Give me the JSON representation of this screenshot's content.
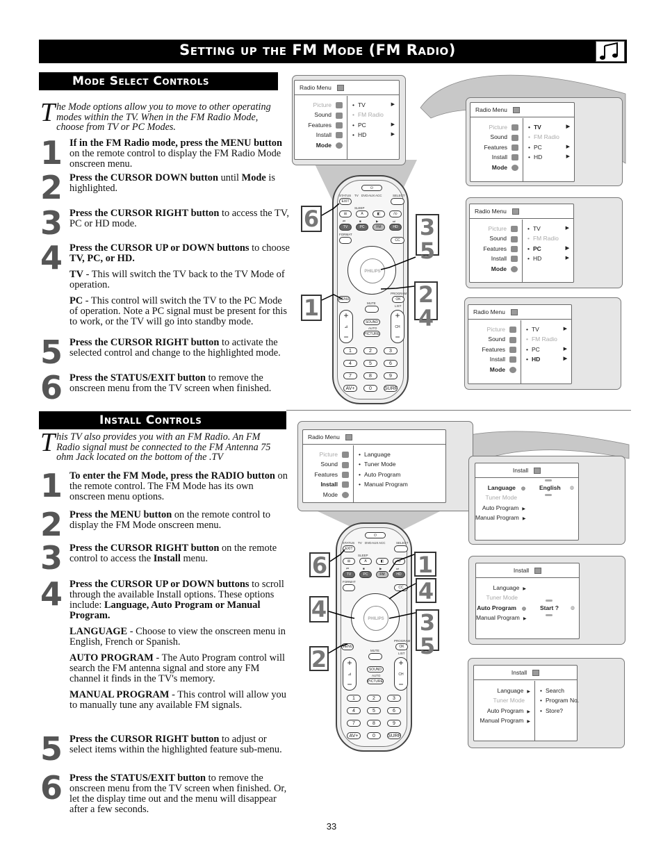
{
  "page_title": "Setting up the FM Mode (FM Radio)",
  "title_icon": "music-note-icon",
  "section1": {
    "heading": "Mode Select Controls",
    "intro_dropcap": "T",
    "intro": "he Mode options allow you to move to other operating modes within the TV. When in the FM Radio Mode, choose from TV or PC Modes.",
    "steps": [
      {
        "num": "1",
        "bold": "If in the FM Radio mode, press the MENU button",
        "rest": " on the remote control to display the FM Radio Mode onscreen menu."
      },
      {
        "num": "2",
        "bold": "Press the CURSOR DOWN button",
        "rest": " until ",
        "bold2": "Mode",
        "rest2": " is highlighted."
      },
      {
        "num": "3",
        "bold": "Press the CURSOR RIGHT button",
        "rest": " to access the TV, PC or HD mode."
      },
      {
        "num": "4",
        "bold": "Press the CURSOR UP or DOWN buttons",
        "rest": " to choose ",
        "bold2": "TV, PC, or HD.",
        "rest2": "",
        "subs": [
          {
            "term": "TV",
            "text": " - This will switch the TV back to the TV Mode of operation."
          },
          {
            "term": "PC",
            "text": " - This control will switch the TV to the PC Mode of operation. Note a PC signal must be present for this to work, or the TV will go into standby mode."
          }
        ]
      },
      {
        "num": "5",
        "bold": "Press the CURSOR RIGHT button",
        "rest": " to activate the selected control and change to the highlighted mode."
      },
      {
        "num": "6",
        "bold": "Press the STATUS/EXIT button",
        "rest": " to remove the onscreen menu from the TV screen when finished."
      }
    ],
    "radio_menu": {
      "title": "Radio Menu",
      "left_items": [
        "Picture",
        "Sound",
        "Features",
        "Install",
        "Mode"
      ],
      "right_items": [
        "TV",
        "FM Radio",
        "PC",
        "HD"
      ]
    },
    "highlight_states": [
      "TV",
      "PC",
      "HD"
    ],
    "callouts": {
      "left_top": "6",
      "left_bottom": "1",
      "right_top": "3\n5",
      "right_bottom": "2\n4"
    }
  },
  "section2": {
    "heading": "Install Controls",
    "intro_dropcap": "T",
    "intro": "his TV also provides you with an FM Radio. An FM Radio signal must be connected to the FM Antenna 75 ohm Jack located on the bottom of the .TV",
    "steps": [
      {
        "num": "1",
        "bold": "To enter the FM Mode, press the RADIO button",
        "rest": " on the remote control. The FM Mode has its own onscreen menu options."
      },
      {
        "num": "2",
        "bold": "Press the MENU button",
        "rest": " on the remote control to display the FM Mode onscreen menu."
      },
      {
        "num": "3",
        "bold": "Press the CURSOR RIGHT button",
        "rest": " on the remote control to access the ",
        "bold2": "Install",
        "rest2": " menu."
      },
      {
        "num": "4",
        "bold": "Press the CURSOR UP or DOWN buttons",
        "rest": " to scroll through the available Install options. These options include: ",
        "bold2": "Language, Auto Program or Manual Program.",
        "rest2": "",
        "subs": [
          {
            "term": "LANGUAGE",
            "text": " - Choose to view the onscreen menu in English, French or Spanish."
          },
          {
            "term": "AUTO PROGRAM",
            "text": " - The Auto Program control will search the FM antenna signal and store any FM channel it finds in the TV's memory."
          },
          {
            "term": "MANUAL PROGRAM",
            "text": " - This control will allow you to manually tune any available FM signals."
          }
        ]
      },
      {
        "num": "5",
        "bold": "Press the CURSOR RIGHT button",
        "rest": " to adjust or select items within the highlighted feature sub-menu."
      },
      {
        "num": "6",
        "bold": "Press the STATUS/EXIT button",
        "rest": " to remove the onscreen menu from the TV screen when finished. Or, let the display time out and the menu will disappear after a few seconds."
      }
    ],
    "radio_menu": {
      "title": "Radio Menu",
      "left_items": [
        "Picture",
        "Sound",
        "Features",
        "Install",
        "Mode"
      ],
      "right_items": [
        "Language",
        "Tuner Mode",
        "Auto Program",
        "Manual Program"
      ]
    },
    "install_menu": {
      "title": "Install",
      "items": [
        "Language",
        "Tuner Mode",
        "Auto Program",
        "Manual Program"
      ],
      "language_value": "English",
      "auto_program_value": "Start ?",
      "manual_sub": [
        "Search",
        "Program No.",
        "Store?"
      ]
    },
    "callouts": {
      "left_top": "6",
      "left_mid": "4",
      "left_bottom": "2",
      "right_top": "1",
      "right_mid": "4",
      "right_bottom": "3\n5"
    }
  },
  "remote": {
    "brand": "PHILIPS",
    "buttons": {
      "power": "⏻",
      "status": "STATUS",
      "exit": "EXIT",
      "select": "SELECT",
      "sources": [
        "TV",
        "DVD",
        "AUX",
        "ACC"
      ],
      "sleep": "SLEEP",
      "row2": [
        "⊞",
        "A",
        "◧",
        "/⊙"
      ],
      "row3": [
        "TV",
        "PC",
        "FM",
        "HD"
      ],
      "transport": [
        "⏮",
        "■",
        "▶",
        "⏭"
      ],
      "format": "FORMAT",
      "cc": "CC",
      "menu": "MENU",
      "program": "PROGRAM",
      "ok": "OK",
      "mute": "MUTE",
      "list": "LIST",
      "vol": "⊿",
      "ch": "CH",
      "sound": "SOUND",
      "auto": "AUTO",
      "picture": "PICTURE",
      "digits": [
        "1",
        "2",
        "3",
        "4",
        "5",
        "6",
        "7",
        "8",
        "9",
        "AV+",
        "0",
        "SURF"
      ]
    }
  },
  "page_number": "33"
}
